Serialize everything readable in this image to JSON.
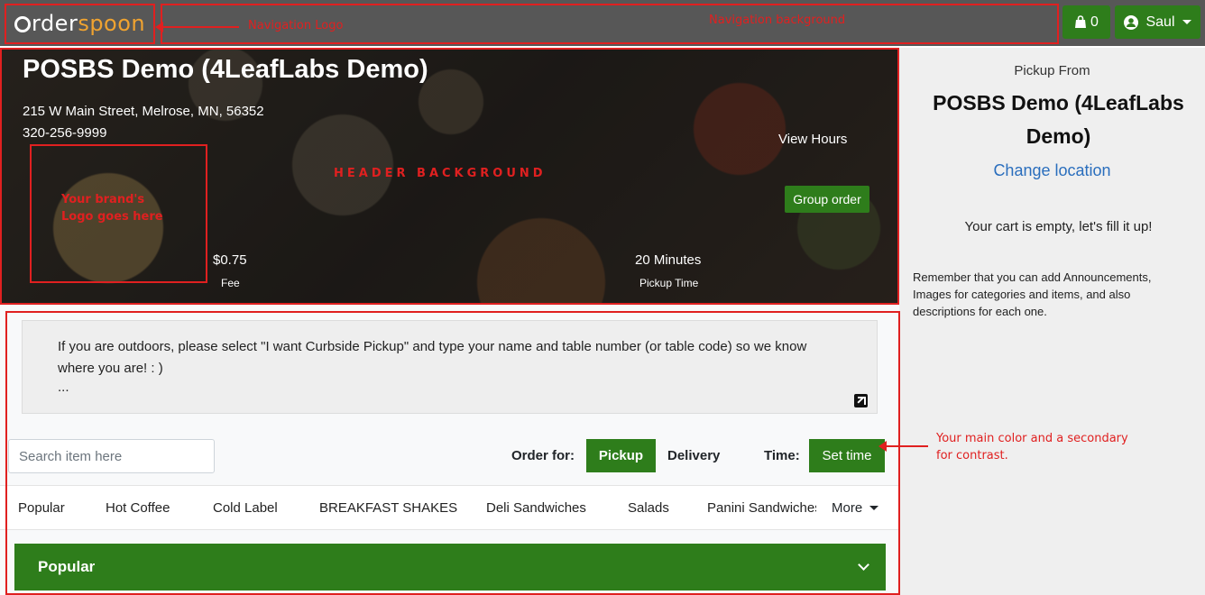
{
  "nav": {
    "logo_left": "rder",
    "logo_right": "spoon",
    "cart_count": "0",
    "user_name": "Saul"
  },
  "header": {
    "store_title": "POSBS Demo (4LeafLabs Demo)",
    "address": "215 W Main Street, Melrose, MN, 56352",
    "phone": "320-256-9999",
    "view_hours": "View Hours",
    "group_order": "Group order",
    "fee_value": "$0.75",
    "fee_label": "Fee",
    "time_value": "20 Minutes",
    "time_label": "Pickup Time"
  },
  "sidebar": {
    "pickup_from": "Pickup From",
    "store_name": "POSBS Demo (4LeafLabs Demo)",
    "change_location": "Change location",
    "cart_empty": "Your cart is empty, let's fill it up!",
    "note": "Remember that you can add Announcements, Images for categories and items, and also descriptions for each one."
  },
  "main": {
    "announcement": "If you are outdoors, please select \"I want Curbside Pickup\" and type your name and table number (or table code)  so we know where you are! : )",
    "announcement_more": "...",
    "search_placeholder": "Search item here",
    "order_for_label": "Order for:",
    "pickup_label": "Pickup",
    "delivery_label": "Delivery",
    "time_label": "Time:",
    "set_time_label": "Set time",
    "categories": [
      "Popular",
      "Hot Coffee",
      "Cold Label",
      "BREAKFAST SHAKES",
      "Deli Sandwiches",
      "Salads",
      "Panini Sandwiches"
    ],
    "more_label": "More",
    "section_title": "Popular"
  },
  "annotations": {
    "nav_logo": "Navigation Logo",
    "nav_background": "Navigation background",
    "header_background": "HEADER BACKGROUND",
    "brand_logo": "Your brand's Logo goes here",
    "main_color": "Your main color and a secondary for contrast."
  },
  "colors": {
    "nav_bg": "#575757",
    "primary": "#2e7d1b",
    "accent": "#f0a330",
    "link": "#2a6ebd",
    "annotation": "#e02020"
  }
}
